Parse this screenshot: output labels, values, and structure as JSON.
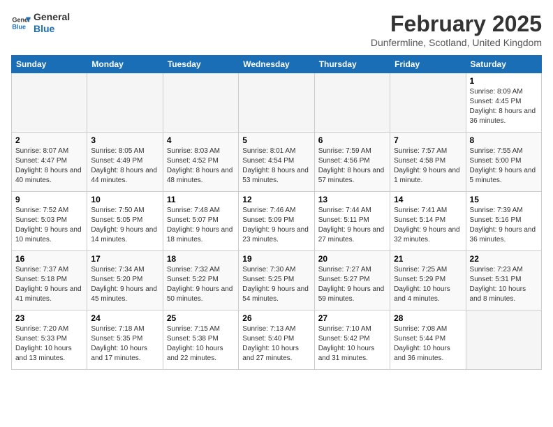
{
  "logo": {
    "line1": "General",
    "line2": "Blue"
  },
  "title": "February 2025",
  "subtitle": "Dunfermline, Scotland, United Kingdom",
  "days_header": [
    "Sunday",
    "Monday",
    "Tuesday",
    "Wednesday",
    "Thursday",
    "Friday",
    "Saturday"
  ],
  "weeks": [
    [
      {
        "day": "",
        "info": ""
      },
      {
        "day": "",
        "info": ""
      },
      {
        "day": "",
        "info": ""
      },
      {
        "day": "",
        "info": ""
      },
      {
        "day": "",
        "info": ""
      },
      {
        "day": "",
        "info": ""
      },
      {
        "day": "1",
        "info": "Sunrise: 8:09 AM\nSunset: 4:45 PM\nDaylight: 8 hours and 36 minutes."
      }
    ],
    [
      {
        "day": "2",
        "info": "Sunrise: 8:07 AM\nSunset: 4:47 PM\nDaylight: 8 hours and 40 minutes."
      },
      {
        "day": "3",
        "info": "Sunrise: 8:05 AM\nSunset: 4:49 PM\nDaylight: 8 hours and 44 minutes."
      },
      {
        "day": "4",
        "info": "Sunrise: 8:03 AM\nSunset: 4:52 PM\nDaylight: 8 hours and 48 minutes."
      },
      {
        "day": "5",
        "info": "Sunrise: 8:01 AM\nSunset: 4:54 PM\nDaylight: 8 hours and 53 minutes."
      },
      {
        "day": "6",
        "info": "Sunrise: 7:59 AM\nSunset: 4:56 PM\nDaylight: 8 hours and 57 minutes."
      },
      {
        "day": "7",
        "info": "Sunrise: 7:57 AM\nSunset: 4:58 PM\nDaylight: 9 hours and 1 minute."
      },
      {
        "day": "8",
        "info": "Sunrise: 7:55 AM\nSunset: 5:00 PM\nDaylight: 9 hours and 5 minutes."
      }
    ],
    [
      {
        "day": "9",
        "info": "Sunrise: 7:52 AM\nSunset: 5:03 PM\nDaylight: 9 hours and 10 minutes."
      },
      {
        "day": "10",
        "info": "Sunrise: 7:50 AM\nSunset: 5:05 PM\nDaylight: 9 hours and 14 minutes."
      },
      {
        "day": "11",
        "info": "Sunrise: 7:48 AM\nSunset: 5:07 PM\nDaylight: 9 hours and 18 minutes."
      },
      {
        "day": "12",
        "info": "Sunrise: 7:46 AM\nSunset: 5:09 PM\nDaylight: 9 hours and 23 minutes."
      },
      {
        "day": "13",
        "info": "Sunrise: 7:44 AM\nSunset: 5:11 PM\nDaylight: 9 hours and 27 minutes."
      },
      {
        "day": "14",
        "info": "Sunrise: 7:41 AM\nSunset: 5:14 PM\nDaylight: 9 hours and 32 minutes."
      },
      {
        "day": "15",
        "info": "Sunrise: 7:39 AM\nSunset: 5:16 PM\nDaylight: 9 hours and 36 minutes."
      }
    ],
    [
      {
        "day": "16",
        "info": "Sunrise: 7:37 AM\nSunset: 5:18 PM\nDaylight: 9 hours and 41 minutes."
      },
      {
        "day": "17",
        "info": "Sunrise: 7:34 AM\nSunset: 5:20 PM\nDaylight: 9 hours and 45 minutes."
      },
      {
        "day": "18",
        "info": "Sunrise: 7:32 AM\nSunset: 5:22 PM\nDaylight: 9 hours and 50 minutes."
      },
      {
        "day": "19",
        "info": "Sunrise: 7:30 AM\nSunset: 5:25 PM\nDaylight: 9 hours and 54 minutes."
      },
      {
        "day": "20",
        "info": "Sunrise: 7:27 AM\nSunset: 5:27 PM\nDaylight: 9 hours and 59 minutes."
      },
      {
        "day": "21",
        "info": "Sunrise: 7:25 AM\nSunset: 5:29 PM\nDaylight: 10 hours and 4 minutes."
      },
      {
        "day": "22",
        "info": "Sunrise: 7:23 AM\nSunset: 5:31 PM\nDaylight: 10 hours and 8 minutes."
      }
    ],
    [
      {
        "day": "23",
        "info": "Sunrise: 7:20 AM\nSunset: 5:33 PM\nDaylight: 10 hours and 13 minutes."
      },
      {
        "day": "24",
        "info": "Sunrise: 7:18 AM\nSunset: 5:35 PM\nDaylight: 10 hours and 17 minutes."
      },
      {
        "day": "25",
        "info": "Sunrise: 7:15 AM\nSunset: 5:38 PM\nDaylight: 10 hours and 22 minutes."
      },
      {
        "day": "26",
        "info": "Sunrise: 7:13 AM\nSunset: 5:40 PM\nDaylight: 10 hours and 27 minutes."
      },
      {
        "day": "27",
        "info": "Sunrise: 7:10 AM\nSunset: 5:42 PM\nDaylight: 10 hours and 31 minutes."
      },
      {
        "day": "28",
        "info": "Sunrise: 7:08 AM\nSunset: 5:44 PM\nDaylight: 10 hours and 36 minutes."
      },
      {
        "day": "",
        "info": ""
      }
    ]
  ]
}
